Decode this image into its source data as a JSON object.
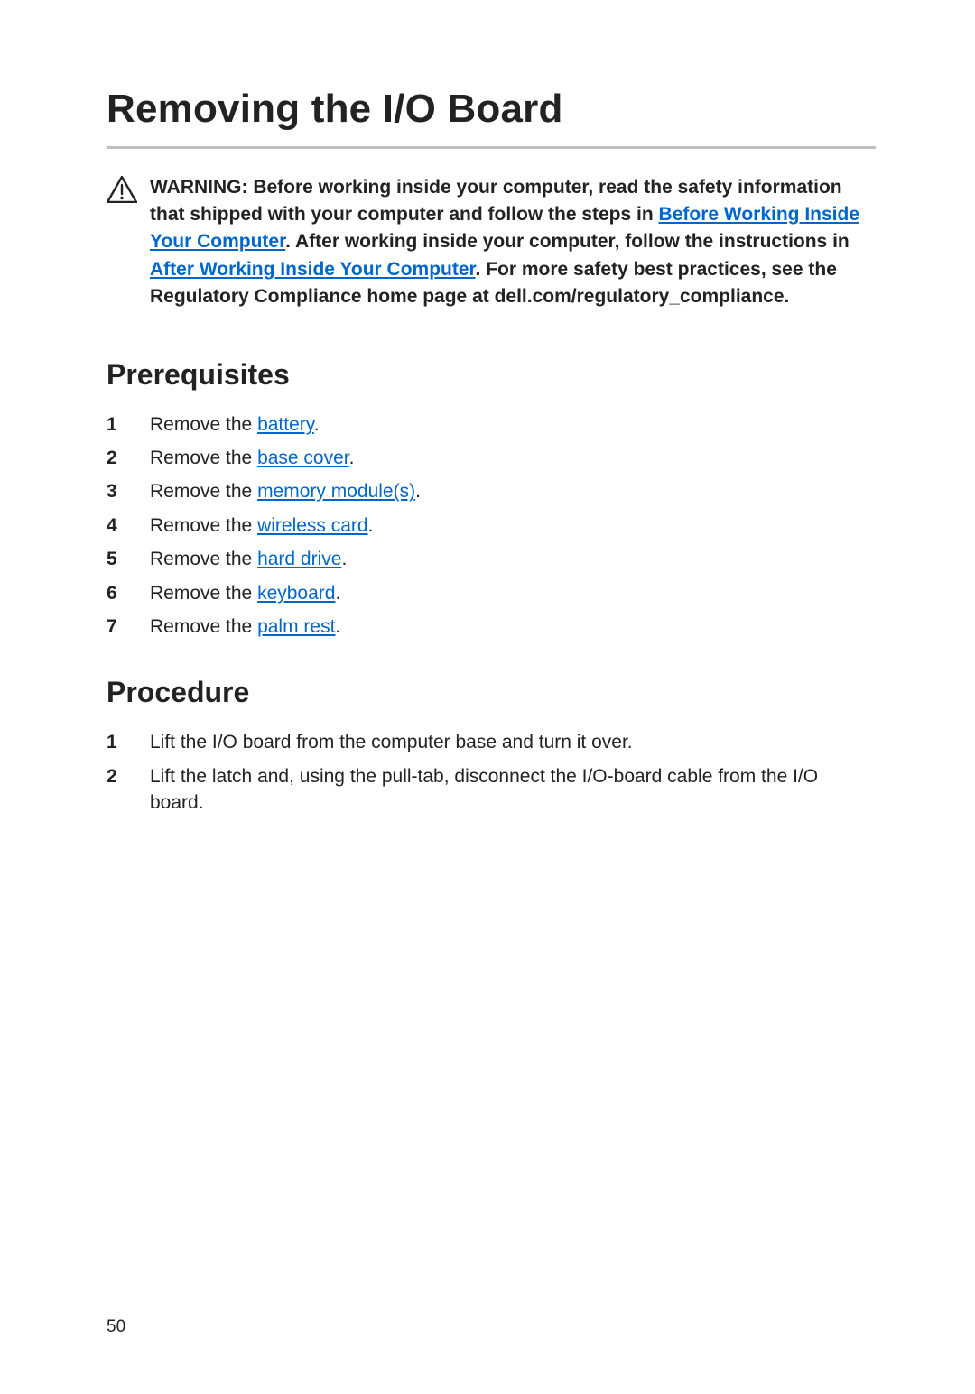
{
  "title": "Removing the I/O Board",
  "warning": {
    "prefix": "WARNING: Before working inside your computer, read the safety information that shipped with your computer and follow the steps in ",
    "link1": "Before Working Inside Your Computer",
    "mid1": ". After working inside your computer, follow the instructions in ",
    "link2": "After Working Inside Your Computer",
    "suffix": ". For more safety best practices, see the Regulatory Compliance home page at dell.com/regulatory_compliance."
  },
  "prerequisites": {
    "heading": "Prerequisites",
    "items": [
      {
        "pre": "Remove the ",
        "link": "battery",
        "post": "."
      },
      {
        "pre": "Remove the ",
        "link": "base cover",
        "post": "."
      },
      {
        "pre": "Remove the ",
        "link": "memory module(s)",
        "post": "."
      },
      {
        "pre": "Remove the ",
        "link": "wireless card",
        "post": "."
      },
      {
        "pre": "Remove the ",
        "link": "hard drive",
        "post": "."
      },
      {
        "pre": "Remove the ",
        "link": "keyboard",
        "post": "."
      },
      {
        "pre": "Remove the ",
        "link": "palm rest",
        "post": "."
      }
    ]
  },
  "procedure": {
    "heading": "Procedure",
    "items": [
      {
        "text": "Lift the I/O board from the computer base and turn it over."
      },
      {
        "text": "Lift the latch and, using the pull-tab, disconnect the I/O-board cable from the I/O board."
      }
    ]
  },
  "page_number": "50"
}
